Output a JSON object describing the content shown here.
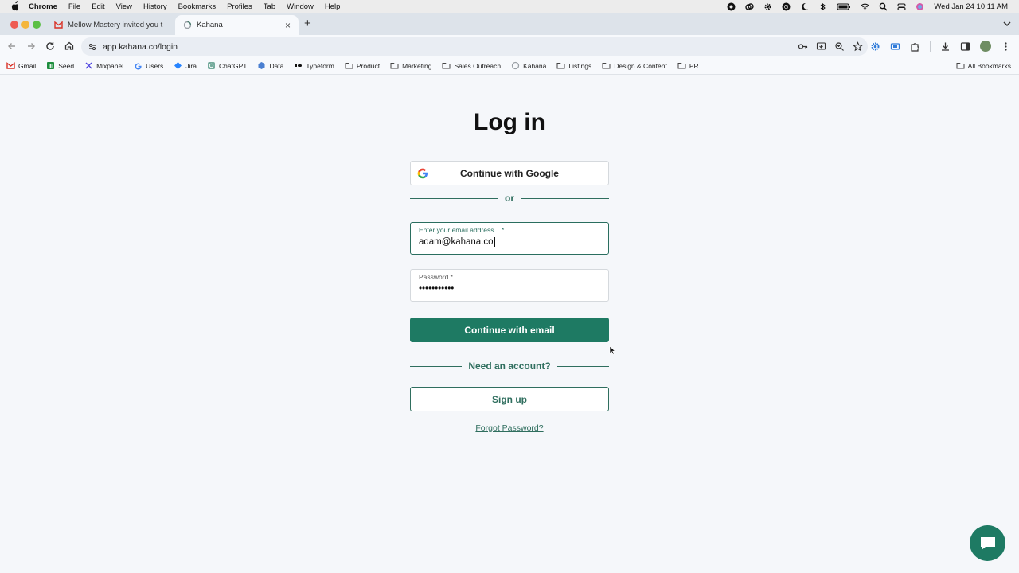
{
  "menubar": {
    "app": "Chrome",
    "items": [
      "File",
      "Edit",
      "View",
      "History",
      "Bookmarks",
      "Profiles",
      "Tab",
      "Window",
      "Help"
    ],
    "clock": "Wed Jan 24  10:11 AM"
  },
  "tabs": [
    {
      "title": "Mellow Mastery invited you t",
      "icon": "gmail-icon"
    },
    {
      "title": "Kahana",
      "icon": "loading-icon"
    }
  ],
  "toolbar": {
    "url": "app.kahana.co/login"
  },
  "bookmarks": {
    "items": [
      {
        "label": "Gmail",
        "icon": "gmail-icon"
      },
      {
        "label": "Seed",
        "icon": "sheets-icon"
      },
      {
        "label": "Mixpanel",
        "icon": "mixpanel-icon"
      },
      {
        "label": "Users",
        "icon": "google-icon"
      },
      {
        "label": "Jira",
        "icon": "jira-icon"
      },
      {
        "label": "ChatGPT",
        "icon": "chatgpt-icon"
      },
      {
        "label": "Data",
        "icon": "data-icon"
      },
      {
        "label": "Typeform",
        "icon": "typeform-icon"
      },
      {
        "label": "Product",
        "icon": "folder-icon"
      },
      {
        "label": "Marketing",
        "icon": "folder-icon"
      },
      {
        "label": "Sales Outreach",
        "icon": "folder-icon"
      },
      {
        "label": "Kahana",
        "icon": "kahana-icon"
      },
      {
        "label": "Listings",
        "icon": "folder-icon"
      },
      {
        "label": "Design & Content",
        "icon": "folder-icon"
      },
      {
        "label": "PR",
        "icon": "folder-icon"
      }
    ],
    "all": "All Bookmarks"
  },
  "login": {
    "title": "Log in",
    "google_button": "Continue with Google",
    "or": "or",
    "email_label": "Enter your email address... *",
    "email_value": "adam@kahana.co",
    "password_label": "Password *",
    "password_value": "•••••••••••",
    "submit": "Continue with email",
    "need_account": "Need an account?",
    "signup": "Sign up",
    "forgot": "Forgot Password?"
  },
  "colors": {
    "brand": "#1e7a63",
    "accent_text": "#2f6e5e",
    "page_bg": "#f5f7fa"
  }
}
